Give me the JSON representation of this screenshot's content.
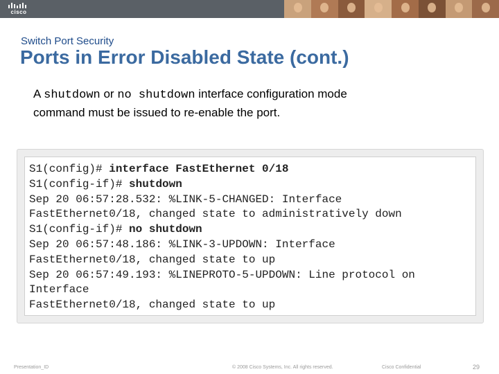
{
  "header": {
    "logo_text": "cisco",
    "photo_colors": [
      "#c9a27c",
      "#b07a55",
      "#8a5a3c",
      "#d6b08a",
      "#a36c48",
      "#7b5136",
      "#c49a74",
      "#9c6a4a"
    ]
  },
  "slide": {
    "section_subtitle": "Switch Port Security",
    "title": "Ports in Error Disabled State (cont.)",
    "description": {
      "prefix": "A ",
      "cmd1": "shutdown",
      "or_text": " or ",
      "cmd2": "no shutdown",
      "rest": " interface configuration mode",
      "line2": "command must be issued to re-enable the port."
    },
    "code_lines": [
      {
        "normal": "S1(config)# ",
        "bold": "interface FastEthernet 0/18"
      },
      {
        "normal": "S1(config-if)# ",
        "bold": "shutdown"
      },
      {
        "normal": "Sep 20 06:57:28.532: %LINK-5-CHANGED: Interface",
        "bold": ""
      },
      {
        "normal": "FastEthernet0/18, changed state to administratively down",
        "bold": ""
      },
      {
        "normal": "S1(config-if)# ",
        "bold": "no shutdown"
      },
      {
        "normal": "Sep 20 06:57:48.186: %LINK-3-UPDOWN: Interface",
        "bold": ""
      },
      {
        "normal": "FastEthernet0/18, changed state to up",
        "bold": ""
      },
      {
        "normal": "Sep 20 06:57:49.193: %LINEPROTO-5-UPDOWN: Line protocol on",
        "bold": ""
      },
      {
        "normal": "Interface",
        "bold": ""
      },
      {
        "normal": "FastEthernet0/18, changed state to up",
        "bold": ""
      }
    ]
  },
  "footer": {
    "presentation_id": "Presentation_ID",
    "copyright": "© 2008 Cisco Systems, Inc. All rights reserved.",
    "confidential": "Cisco Confidential",
    "page_number": "29"
  }
}
